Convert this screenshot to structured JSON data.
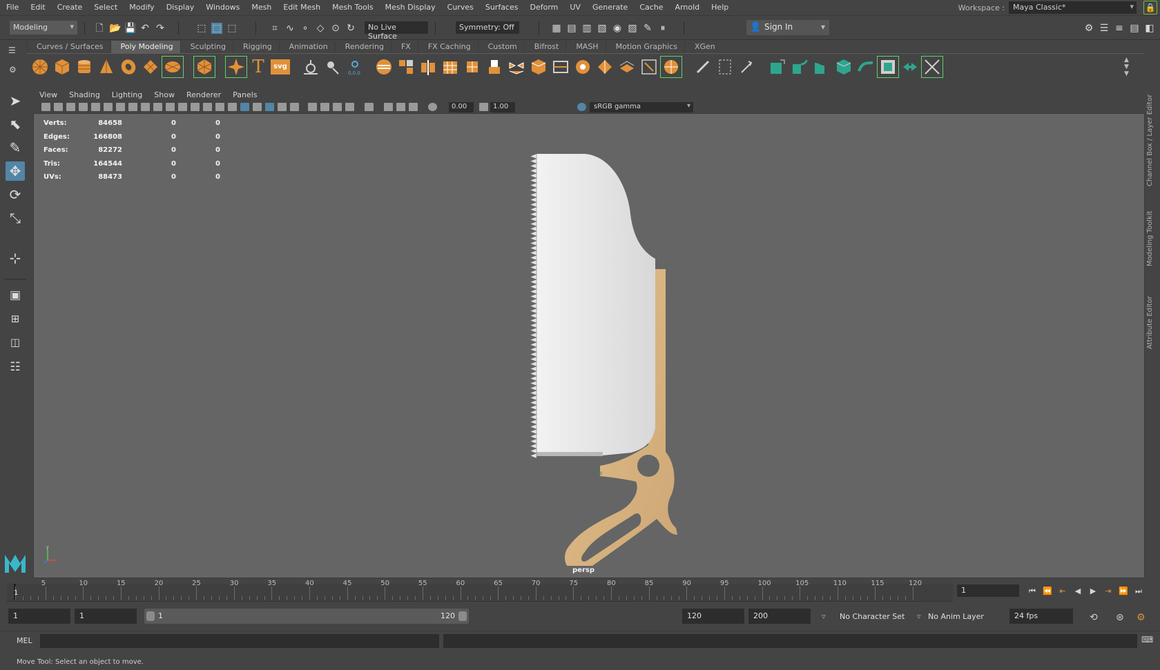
{
  "menubar": {
    "items": [
      "File",
      "Edit",
      "Create",
      "Select",
      "Modify",
      "Display",
      "Windows",
      "Mesh",
      "Edit Mesh",
      "Mesh Tools",
      "Mesh Display",
      "Curves",
      "Surfaces",
      "Deform",
      "UV",
      "Generate",
      "Cache",
      "Arnold",
      "Help"
    ],
    "workspace_label": "Workspace :",
    "workspace_value": "Maya Classic*"
  },
  "statusline": {
    "mode": "Modeling",
    "live_surface": "No Live Surface",
    "symmetry": "Symmetry: Off",
    "sign_in": "Sign In"
  },
  "shelf": {
    "tabs": [
      "Curves / Surfaces",
      "Poly Modeling",
      "Sculpting",
      "Rigging",
      "Animation",
      "Rendering",
      "FX",
      "FX Caching",
      "Custom",
      "Bifrost",
      "MASH",
      "Motion Graphics",
      "XGen"
    ],
    "active_tab": "Poly Modeling",
    "text_icons": {
      "type": "T",
      "svg": "svg"
    }
  },
  "viewport": {
    "menu": [
      "View",
      "Shading",
      "Lighting",
      "Show",
      "Renderer",
      "Panels"
    ],
    "exposure": "0.00",
    "gamma": "1.00",
    "color_space": "sRGB gamma",
    "camera": "persp",
    "axis_y": "y",
    "hud": [
      {
        "label": "Verts:",
        "value": "84658",
        "a": "0",
        "b": "0"
      },
      {
        "label": "Edges:",
        "value": "166808",
        "a": "0",
        "b": "0"
      },
      {
        "label": "Faces:",
        "value": "82272",
        "a": "0",
        "b": "0"
      },
      {
        "label": "Tris:",
        "value": "164544",
        "a": "0",
        "b": "0"
      },
      {
        "label": "UVs:",
        "value": "88473",
        "a": "0",
        "b": "0"
      }
    ]
  },
  "right_strip": {
    "labels": [
      "Channel Box / Layer Editor",
      "Modeling Toolkit",
      "Attribute Editor"
    ]
  },
  "timeslider": {
    "ticks": [
      "1",
      "5",
      "10",
      "15",
      "20",
      "25",
      "30",
      "35",
      "40",
      "45",
      "50",
      "55",
      "60",
      "65",
      "70",
      "75",
      "80",
      "85",
      "90",
      "95",
      "100",
      "105",
      "110",
      "115",
      "120"
    ],
    "current_frame": "1"
  },
  "range": {
    "start": "1",
    "playback_start": "1",
    "slider_start": "1",
    "slider_end": "120",
    "playback_end": "120",
    "end": "200",
    "character_set": "No Character Set",
    "anim_layer": "No Anim Layer",
    "fps": "24 fps"
  },
  "cmdline": {
    "language": "MEL"
  },
  "helpline": {
    "text": "Move Tool: Select an object to move."
  },
  "colors": {
    "ui_bg": "#444444",
    "viewport_bg": "#656565",
    "field_bg": "#2d2d2d",
    "accent_blue": "#5285a6",
    "shelf_orange": "#e0913a",
    "shelf_teal": "#2fa58e",
    "blade": "#dcdcdc",
    "handle": "#d6b282"
  }
}
